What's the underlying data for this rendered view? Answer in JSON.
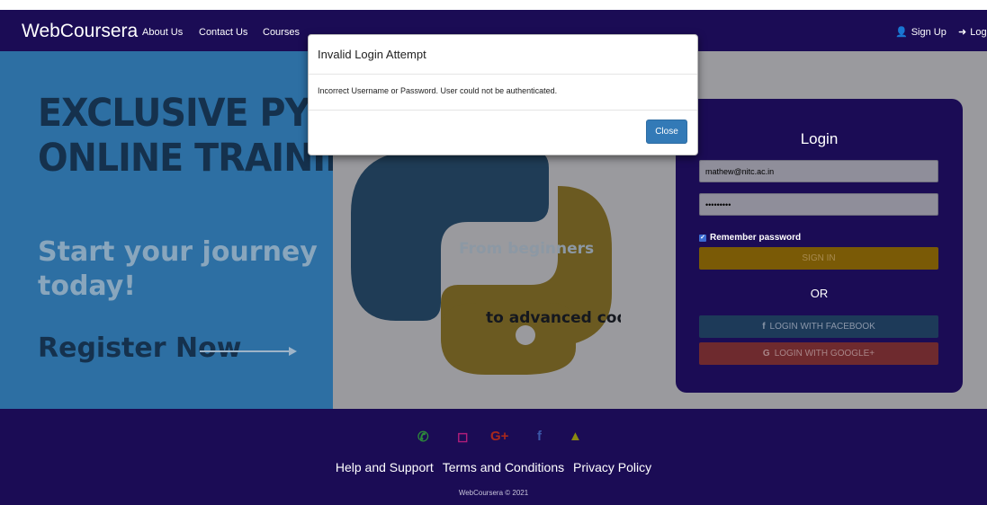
{
  "navbar": {
    "brand": "WebCoursera",
    "links": [
      "About Us",
      "Contact Us",
      "Courses"
    ],
    "signup_label": "Sign Up",
    "login_label": "Logi"
  },
  "hero": {
    "headline_line1": "EXCLUSIVE PYTHON",
    "headline_line2": "ONLINE TRAINING",
    "journey_line1": "Start your journey",
    "journey_line2": "today!",
    "register_label": "Register Now",
    "logo_text1": "From beginners",
    "logo_text2": "to advanced coders"
  },
  "login": {
    "title": "Login",
    "email_value": "mathew@nitc.ac.in",
    "password_value": "•••••••••",
    "remember_label": "Remember password",
    "signin_label": "SIGN IN",
    "or_label": "OR",
    "facebook_label": "LOGIN WITH FACEBOOK",
    "google_label": "LOGIN WITH GOOGLE+"
  },
  "footer": {
    "links": [
      "Help and Support",
      "Terms and Conditions",
      "Privacy Policy"
    ],
    "copyright": "WebCoursera © 2021",
    "social_icons": [
      "whatsapp-icon",
      "instagram-icon",
      "google-plus-icon",
      "facebook-icon",
      "snapchat-icon"
    ]
  },
  "modal": {
    "title": "Invalid Login Attempt",
    "message": "Incorrect Username or Password. User could not be authenticated.",
    "close_label": "Close"
  },
  "colors": {
    "navbar_bg": "#1b0c55",
    "primary_button": "#337ab7",
    "signin": "#e6a40a",
    "facebook": "#3b5998",
    "google": "#dd4b39"
  }
}
